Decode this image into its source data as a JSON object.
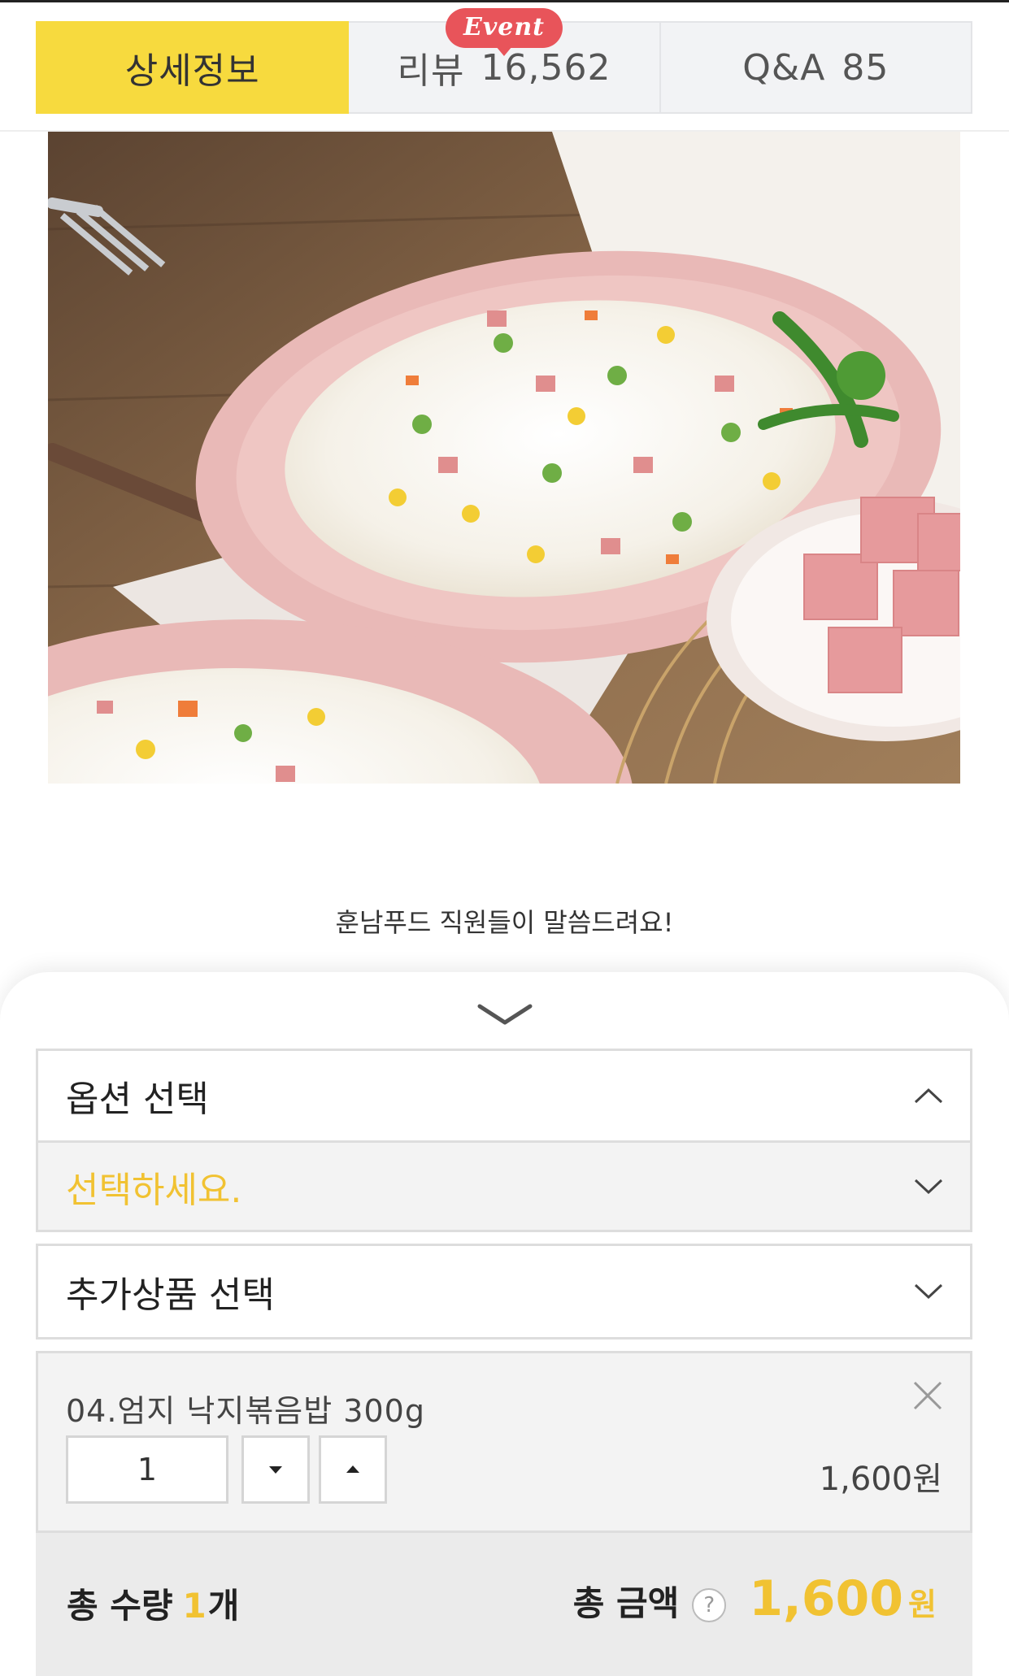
{
  "tabs": {
    "detail": "상세정보",
    "review_label": "리뷰",
    "review_count": "16,562",
    "event_badge": "Event",
    "qna_label": "Q&A",
    "qna_count": "85"
  },
  "caption": "훈남푸드 직원들이 말씀드려요!",
  "options": {
    "title": "옵션 선택",
    "placeholder": "선택하세요.",
    "addon_title": "추가상품 선택"
  },
  "cart_item": {
    "name": "04.엄지 낙지볶음밥 300g",
    "quantity": "1",
    "price": "1,600원"
  },
  "summary": {
    "qty_label": "총 수량",
    "qty_value": "1",
    "qty_unit": "개",
    "amount_label": "총 금액",
    "help": "?",
    "amount_value": "1,600",
    "amount_unit": "원"
  },
  "colors": {
    "accent_yellow": "#f7da3e",
    "price_yellow": "#f1c232",
    "event_red": "#e8545a"
  },
  "icons": [
    "chevron-up-icon",
    "chevron-down-icon",
    "close-icon",
    "caret-down-icon",
    "caret-up-icon",
    "sheet-handle-icon",
    "help-icon"
  ]
}
